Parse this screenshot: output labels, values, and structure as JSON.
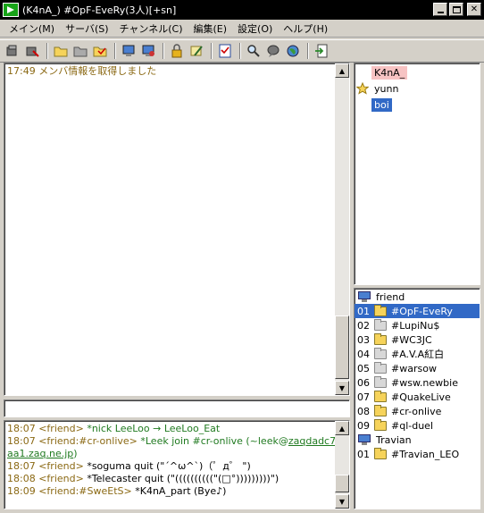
{
  "window": {
    "title": "(K4nA_) #OpF-EveRy(3人)[+sn]"
  },
  "menu": [
    "メイン(M)",
    "サーバ(S)",
    "チャンネル(C)",
    "編集(E)",
    "設定(O)",
    "ヘルプ(H)"
  ],
  "toolbar_icons": [
    "connect-icon",
    "disconnect-icon",
    "join-channel-icon",
    "part-channel-icon",
    "channel-list-icon",
    "server-icon",
    "settings-icon",
    "lock-icon",
    "edit-icon",
    "checklist-icon",
    "search-icon",
    "chat-bubble-icon",
    "globe-icon",
    "exit-icon"
  ],
  "channel_log": [
    {
      "time": "17:49",
      "text": "メンバ情報を取得しました"
    }
  ],
  "members": [
    {
      "name": "K4nA_",
      "mark": "none",
      "color": "#f7c3c3",
      "text_color": "#000000"
    },
    {
      "name": "yunn",
      "mark": "star",
      "color": "",
      "text_color": "#000000"
    },
    {
      "name": "boi",
      "mark": "none",
      "color": "#3169c6",
      "text_color": "#ffffff"
    }
  ],
  "server_tree": [
    {
      "kind": "server",
      "label": "friend"
    },
    {
      "kind": "channel",
      "num": "01",
      "label": "#OpF-EveRy",
      "folder": "yellow",
      "selected": true
    },
    {
      "kind": "channel",
      "num": "02",
      "label": "#LupiNu$",
      "folder": "gray",
      "selected": false
    },
    {
      "kind": "channel",
      "num": "03",
      "label": "#WC3JC",
      "folder": "yellow",
      "selected": false
    },
    {
      "kind": "channel",
      "num": "04",
      "label": "#A.V.A紅白",
      "folder": "gray",
      "selected": false
    },
    {
      "kind": "channel",
      "num": "05",
      "label": "#warsow",
      "folder": "gray",
      "selected": false
    },
    {
      "kind": "channel",
      "num": "06",
      "label": "#wsw.newbie",
      "folder": "gray",
      "selected": false
    },
    {
      "kind": "channel",
      "num": "07",
      "label": "#QuakeLive",
      "folder": "yellow",
      "selected": false
    },
    {
      "kind": "channel",
      "num": "08",
      "label": "#cr-onlive",
      "folder": "yellow",
      "selected": false
    },
    {
      "kind": "channel",
      "num": "09",
      "label": "#ql-duel",
      "folder": "yellow",
      "selected": false
    },
    {
      "kind": "server",
      "label": "Travian"
    },
    {
      "kind": "channel",
      "num": "01",
      "label": "#Travian_LEO",
      "folder": "yellow",
      "selected": false
    }
  ],
  "input": {
    "value": ""
  },
  "free_log": [
    {
      "time": "18:07",
      "parts": [
        {
          "t": "<friend> ",
          "c": "olive"
        },
        {
          "t": "*nick LeeLoo → LeeLoo_Eat",
          "c": "green"
        }
      ]
    },
    {
      "time": "18:07",
      "parts": [
        {
          "t": "<friend:#cr-onlive> ",
          "c": "olive"
        },
        {
          "t": "*Leek join #cr-onlive (~leek@",
          "c": "green"
        },
        {
          "t": "zaqdadc7",
          "c": "link"
        }
      ]
    },
    {
      "time": "",
      "parts": [
        {
          "t": "aa1.zaq.ne.jp",
          "c": "link"
        },
        {
          "t": ")",
          "c": "green"
        }
      ]
    },
    {
      "time": "18:07",
      "parts": [
        {
          "t": "<friend> ",
          "c": "olive"
        },
        {
          "t": "*soguma quit (\"´^ω^`)（゜д゜ \")",
          "c": "black"
        }
      ]
    },
    {
      "time": "18:08",
      "parts": [
        {
          "t": "<friend> ",
          "c": "olive"
        },
        {
          "t": "*Telecaster quit (\"((((((((((\"(□°)))))))))\")",
          "c": "black"
        }
      ]
    },
    {
      "time": "18:09",
      "parts": [
        {
          "t": "<friend:#SweEtS> ",
          "c": "olive"
        },
        {
          "t": "*K4nA_part (Bye♪)",
          "c": "black"
        }
      ]
    }
  ],
  "colors": {
    "accent": "#3169c6",
    "self_nick": "#f7c3c3",
    "log_olive": "#8b6914",
    "log_green": "#207a20"
  }
}
